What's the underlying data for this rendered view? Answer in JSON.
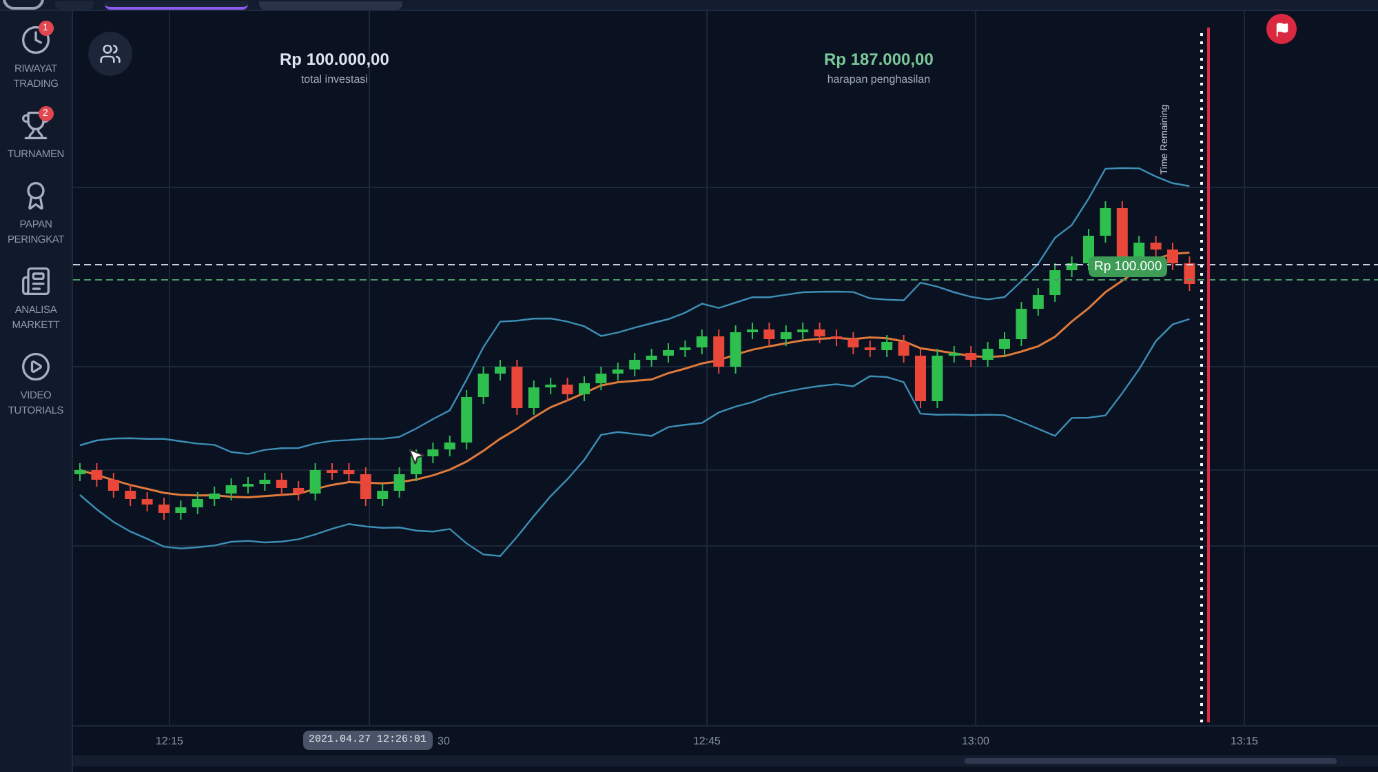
{
  "top_bar": {
    "tabs": [
      {
        "selected": true
      },
      {
        "selected": false
      }
    ]
  },
  "sidebar": {
    "items": [
      {
        "kind": "history",
        "label": "RIWAYAT TRADING",
        "badge": "1"
      },
      {
        "kind": "tournament",
        "label": "TURNAMEN",
        "badge": "2"
      },
      {
        "kind": "leaderboard",
        "label": "PAPAN PERINGKAT"
      },
      {
        "kind": "analysis",
        "label": "ANALISA MARKETT"
      },
      {
        "kind": "video",
        "label": "VIDEO TUTORIALS"
      }
    ]
  },
  "investment": {
    "amount": "Rp 100.000,00",
    "label": "total investasi"
  },
  "expected_income": {
    "amount": "Rp 187.000,00",
    "label": "harapan penghasilan"
  },
  "price_tag": "Rp 100.000",
  "time_remaining_label": "Time Remaining",
  "x_axis": {
    "labels": [
      "12:15",
      "30",
      "12:45",
      "13:00",
      "13:15"
    ]
  },
  "cursor_time": "2021.04.27 12:26:01"
}
